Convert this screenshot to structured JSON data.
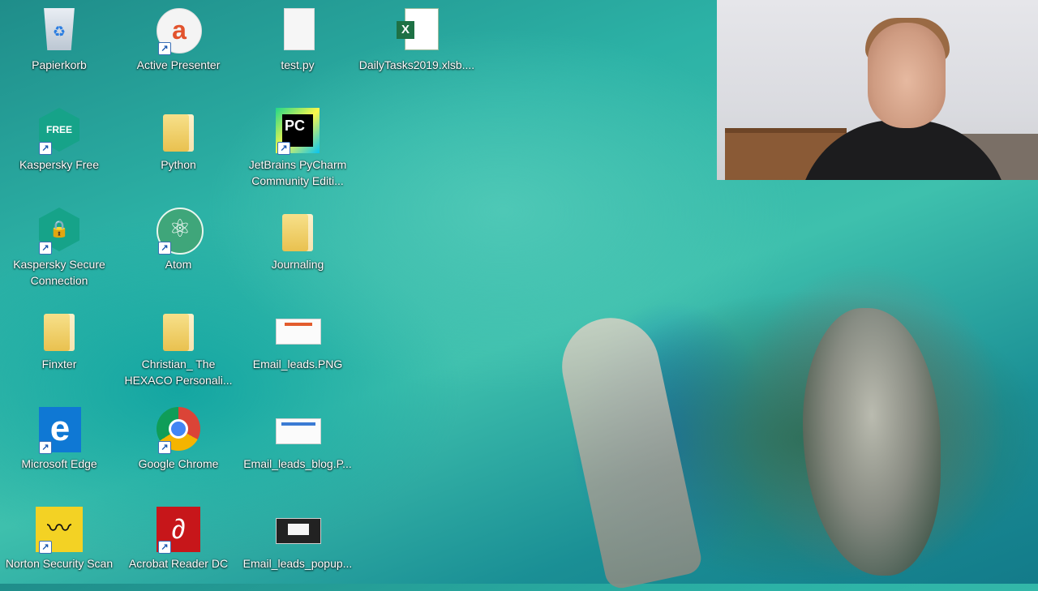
{
  "desktop_icons": [
    {
      "label": "Papierkorb",
      "icon": "recycle-bin-icon"
    },
    {
      "label": "Active Presenter",
      "icon": "active-presenter-icon"
    },
    {
      "label": "test.py",
      "icon": "python-file-icon"
    },
    {
      "label": "DailyTasks2019.xlsb....",
      "icon": "excel-file-icon"
    },
    {
      "label": "Kaspersky Free",
      "icon": "kaspersky-free-icon",
      "badge": "FREE"
    },
    {
      "label": "Python",
      "icon": "folder-icon"
    },
    {
      "label": "JetBrains PyCharm Community Editi...",
      "icon": "pycharm-icon",
      "badge": "PC"
    },
    {
      "label": "Kaspersky Secure Connection",
      "icon": "kaspersky-secure-connection-icon"
    },
    {
      "label": "Atom",
      "icon": "atom-icon"
    },
    {
      "label": "Journaling",
      "icon": "folder-icon"
    },
    {
      "label": "Finxter",
      "icon": "folder-icon"
    },
    {
      "label": "Christian_ The HEXACO Personali...",
      "icon": "folder-icon"
    },
    {
      "label": "Email_leads.PNG",
      "icon": "image-file-icon"
    },
    {
      "label": "Microsoft Edge",
      "icon": "edge-icon",
      "badge": "e"
    },
    {
      "label": "Google Chrome",
      "icon": "chrome-icon"
    },
    {
      "label": "Email_leads_blog.P...",
      "icon": "image-file-icon"
    },
    {
      "label": "Norton Security Scan",
      "icon": "norton-icon"
    },
    {
      "label": "Acrobat Reader DC",
      "icon": "acrobat-icon"
    },
    {
      "label": "Email_leads_popup...",
      "icon": "image-file-icon"
    }
  ],
  "webcam": {
    "description": "presenter-webcam-overlay"
  },
  "colors": {
    "wallpaper_base": "#2cb2a6",
    "excel_green": "#1e7145",
    "edge_blue": "#0f78d4",
    "acrobat_red": "#c7161a",
    "norton_yellow": "#f3d224"
  }
}
